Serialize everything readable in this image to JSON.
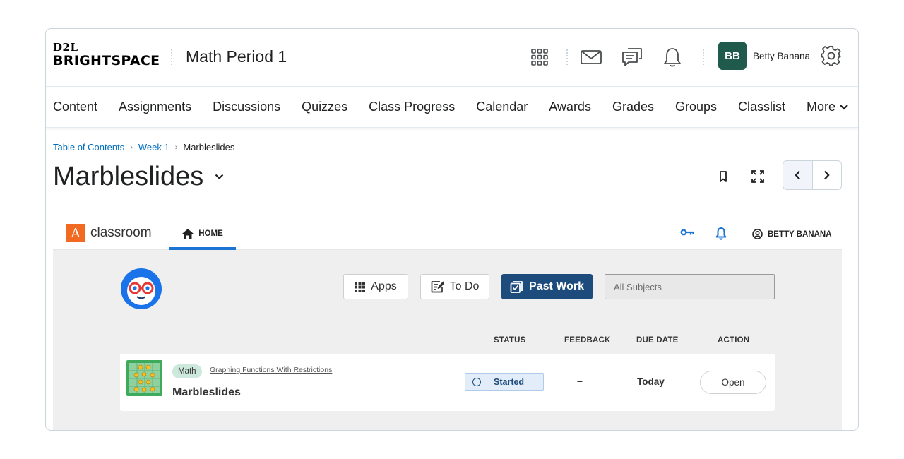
{
  "header": {
    "logo_top": "D2L",
    "logo_bottom": "BRIGHTSPACE",
    "course_title": "Math Period 1",
    "avatar_initials": "BB",
    "user_name": "Betty Banana"
  },
  "nav": {
    "items": [
      "Content",
      "Assignments",
      "Discussions",
      "Quizzes",
      "Class Progress",
      "Calendar",
      "Awards",
      "Grades",
      "Groups",
      "Classlist"
    ],
    "more_label": "More"
  },
  "breadcrumb": {
    "items": [
      "Table of Contents",
      "Week 1"
    ],
    "current": "Marbleslides"
  },
  "page": {
    "title": "Marbleslides"
  },
  "classroom": {
    "brand_letter": "A",
    "brand_word": "classroom",
    "home_tab": "HOME",
    "user_label": "BETTY BANANA",
    "buttons": {
      "apps": "Apps",
      "todo": "To Do",
      "past_work": "Past Work"
    },
    "subjects_placeholder": "All Subjects",
    "columns": {
      "status": "STATUS",
      "feedback": "FEEDBACK",
      "due_date": "DUE DATE",
      "action": "ACTION"
    },
    "row": {
      "subject": "Math",
      "unit": "Graphing Functions With Restrictions",
      "title": "Marbleslides",
      "status": "Started",
      "feedback": "–",
      "due": "Today",
      "action": "Open"
    },
    "colors": {
      "accent": "#1b74d3",
      "primary_button": "#1d4c7c",
      "brand_orange": "#f26a21",
      "avatar": "#1f5a4d"
    }
  }
}
